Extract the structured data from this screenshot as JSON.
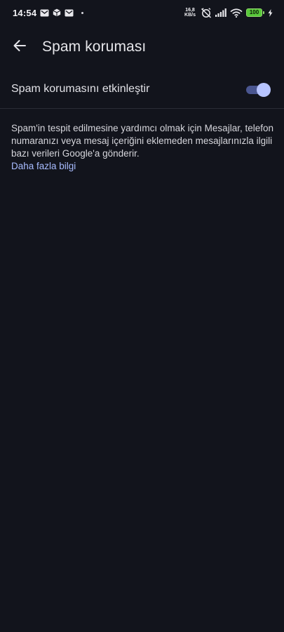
{
  "status_bar": {
    "time": "14:54",
    "net_speed_value": "16,8",
    "net_speed_unit": "KB/s",
    "battery_level": "100",
    "icons": [
      "gmail-icon",
      "package-icon",
      "gmail-icon",
      "dot-icon",
      "alarm-off-icon",
      "signal-icon",
      "wifi-icon",
      "charging-icon"
    ]
  },
  "app_bar": {
    "back_icon": "arrow-back-icon",
    "title": "Spam koruması"
  },
  "settings": {
    "toggle_label": "Spam korumasını etkinleştir",
    "toggle_on": true
  },
  "description": {
    "text": "Spam'in tespit edilmesine yardımcı olmak için Mesajlar, telefon numaranızı veya mesaj içeriğini eklemeden mesajlarınızla ilgili bazı verileri Google'a gönderir.",
    "link": "Daha fazla bilgi"
  },
  "colors": {
    "background": "#12141c",
    "accent_link": "#a8bcff",
    "switch_thumb": "#b7c4ff",
    "switch_track": "#4a5690",
    "battery": "#58c93a"
  }
}
